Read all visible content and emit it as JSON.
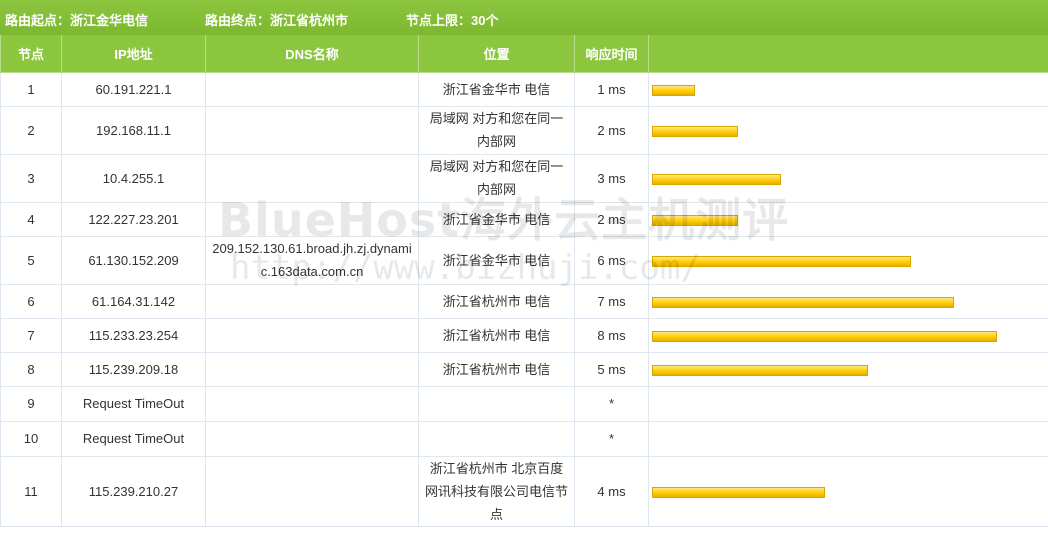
{
  "header": {
    "origin": "路由起点：浙江金华电信",
    "destination": "路由终点：浙江省杭州市",
    "limit": "节点上限：30个"
  },
  "columns": [
    "节点",
    "IP地址",
    "DNS名称",
    "位置",
    "响应时间",
    ""
  ],
  "rows": [
    {
      "node": "1",
      "ip": "60.191.221.1",
      "dns": "",
      "location": "浙江省金华市 电信",
      "time": "1 ms",
      "bar_ms": 1
    },
    {
      "node": "2",
      "ip": "192.168.11.1",
      "dns": "",
      "location": "局域网 对方和您在同一内部网",
      "time": "2 ms",
      "bar_ms": 2
    },
    {
      "node": "3",
      "ip": "10.4.255.1",
      "dns": "",
      "location": "局域网 对方和您在同一内部网",
      "time": "3 ms",
      "bar_ms": 3
    },
    {
      "node": "4",
      "ip": "122.227.23.201",
      "dns": "",
      "location": "浙江省金华市 电信",
      "time": "2 ms",
      "bar_ms": 2
    },
    {
      "node": "5",
      "ip": "61.130.152.209",
      "dns": "209.152.130.61.broad.jh.zj.dynamic.163data.com.cn",
      "location": "浙江省金华市 电信",
      "time": "6 ms",
      "bar_ms": 6
    },
    {
      "node": "6",
      "ip": "61.164.31.142",
      "dns": "",
      "location": "浙江省杭州市 电信",
      "time": "7 ms",
      "bar_ms": 7
    },
    {
      "node": "7",
      "ip": "115.233.23.254",
      "dns": "",
      "location": "浙江省杭州市 电信",
      "time": "8 ms",
      "bar_ms": 8
    },
    {
      "node": "8",
      "ip": "115.239.209.18",
      "dns": "",
      "location": "浙江省杭州市 电信",
      "time": "5 ms",
      "bar_ms": 5
    },
    {
      "node": "9",
      "ip": "Request TimeOut",
      "dns": "",
      "location": "",
      "time": "*",
      "bar_ms": 0
    },
    {
      "node": "10",
      "ip": "Request TimeOut",
      "dns": "",
      "location": "",
      "time": "*",
      "bar_ms": 0
    },
    {
      "node": "11",
      "ip": "115.239.210.27",
      "dns": "",
      "location": "浙江省杭州市 北京百度网讯科技有限公司电信节点",
      "time": "4 ms",
      "bar_ms": 4
    }
  ],
  "watermark": {
    "line1": "BlueHost海外云主机测评",
    "line2": "http://www.bizhuji.com/"
  },
  "colors": {
    "header_green": "#8cc63f",
    "bar_yellow": "#ffcc00"
  }
}
